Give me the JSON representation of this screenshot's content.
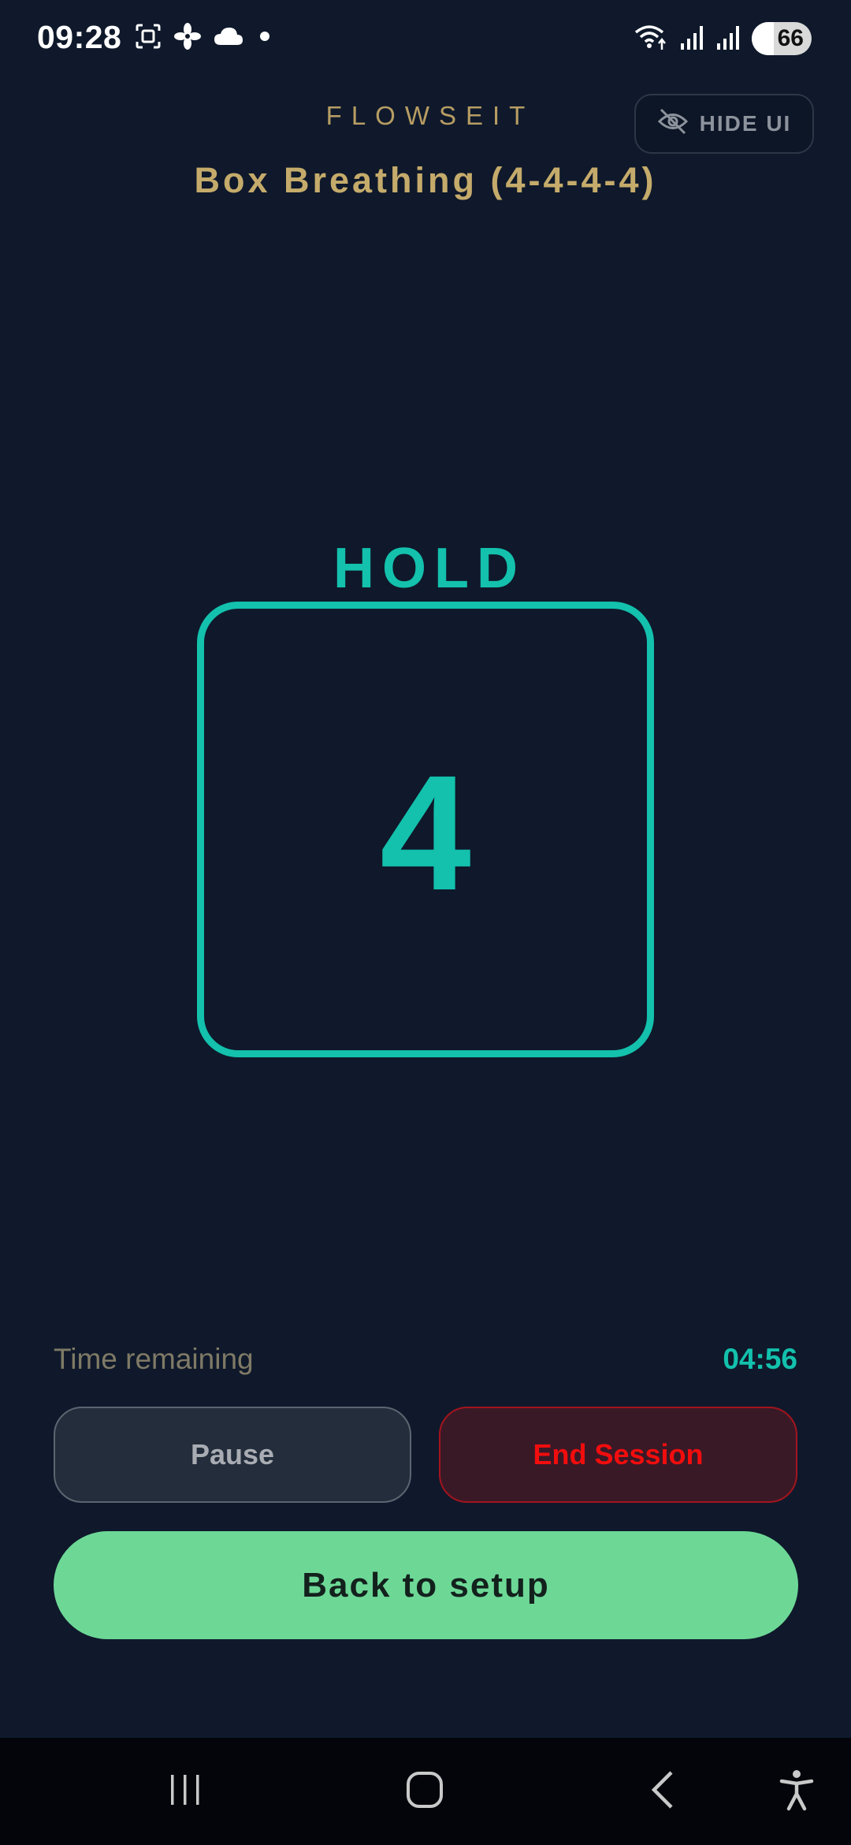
{
  "status_bar": {
    "time": "09:28",
    "battery": "66",
    "left_icons": [
      "screenshot-icon",
      "fan-icon",
      "cloud-icon",
      "dot-icon"
    ],
    "right_icons": [
      "wifi-icon",
      "signal-icon",
      "signal-icon"
    ]
  },
  "header": {
    "app_name": "FLOWSEIT",
    "hide_ui_label": "HIDE UI",
    "session_title": "Box Breathing (4-4-4-4)"
  },
  "breath": {
    "phase": "HOLD",
    "count": "4"
  },
  "footer": {
    "time_remaining_label": "Time remaining",
    "time_remaining_value": "04:56",
    "pause_label": "Pause",
    "end_label": "End Session",
    "back_label": "Back to setup"
  },
  "colors": {
    "background": "#0f192b",
    "accent": "#13c1ad",
    "gold": "#c5ab6b",
    "danger": "#f20d0d",
    "primary_button": "#6dd896"
  },
  "nav_bar": {
    "icons": [
      "recent-apps-icon",
      "home-icon",
      "back-icon",
      "accessibility-icon"
    ]
  }
}
